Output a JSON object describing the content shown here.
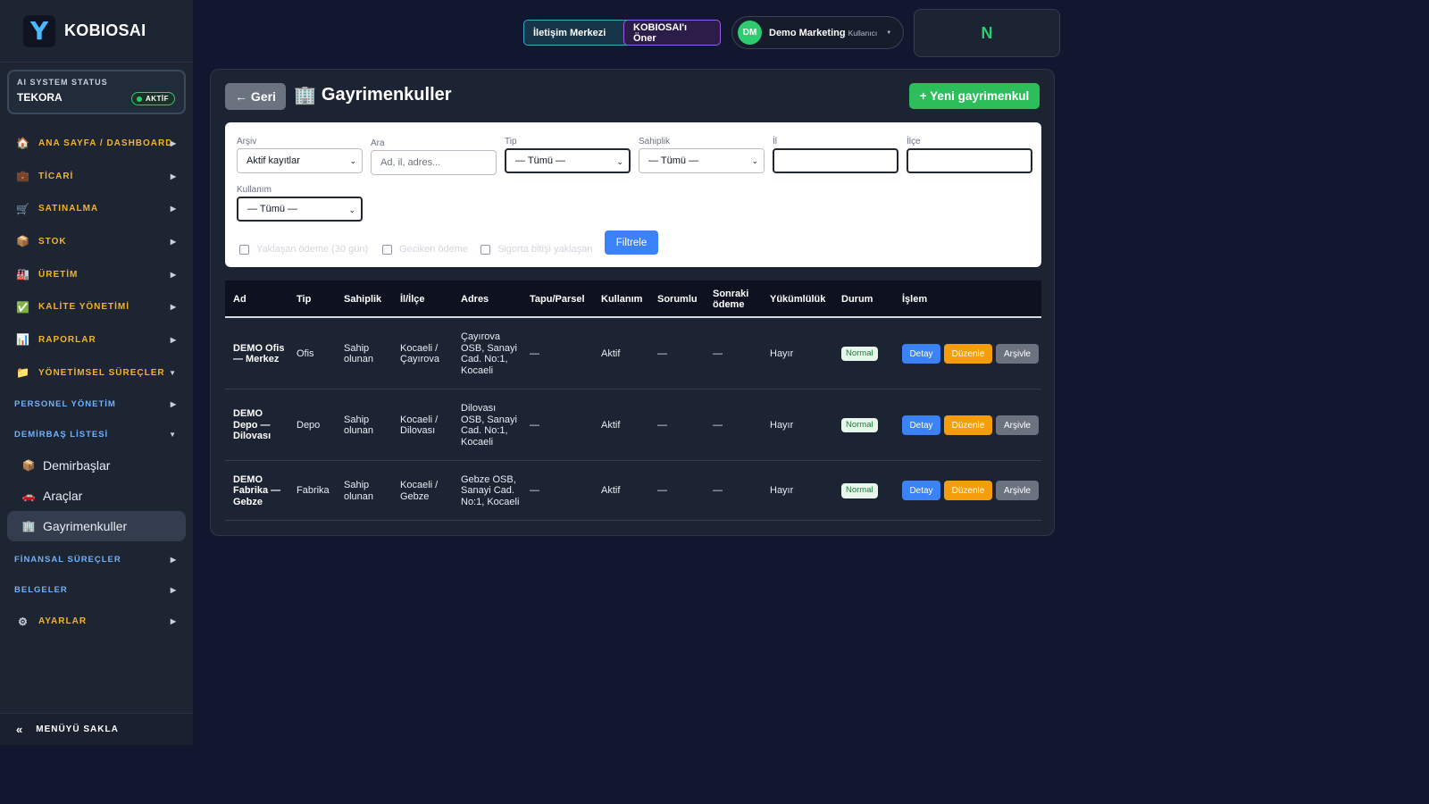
{
  "brand": {
    "logo_letter": "Y",
    "name": "KOBIOSAI"
  },
  "ai_status": {
    "label": "AI SYSTEM STATUS",
    "name": "TEKORA",
    "badge": "AKTİF"
  },
  "nav": {
    "items": [
      {
        "label": "ANA SAYFA / DASHBOARD",
        "icon": "house-icon",
        "glyph": "🏠",
        "arrow": "▶"
      },
      {
        "label": "TİCARİ",
        "icon": "briefcase-icon",
        "glyph": "💼",
        "arrow": "▶"
      },
      {
        "label": "SATINALMA",
        "icon": "cart-icon",
        "glyph": "🛒",
        "arrow": "▶"
      },
      {
        "label": "STOK",
        "icon": "box-icon",
        "glyph": "📦",
        "arrow": "▶"
      },
      {
        "label": "ÜRETİM",
        "icon": "factory-icon",
        "glyph": "🏭",
        "arrow": "▶"
      },
      {
        "label": "KALİTE YÖNETİMİ",
        "icon": "check-icon",
        "glyph": "✅",
        "arrow": "▶"
      },
      {
        "label": "RAPORLAR",
        "icon": "chart-icon",
        "glyph": "📊",
        "arrow": "▶"
      },
      {
        "label": "YÖNETİMSEL SÜREÇLER",
        "icon": "folder-icon",
        "glyph": "📁",
        "arrow": "▼"
      }
    ],
    "section_personnel": {
      "label": "PERSONEL YÖNETİM",
      "arrow": "▶"
    },
    "section_assets": {
      "label": "DEMİRBAŞ LİSTESİ",
      "arrow": "▼"
    },
    "asset_items": [
      {
        "label": "Demirbaşlar",
        "icon": "box-icon",
        "glyph": "📦"
      },
      {
        "label": "Araçlar",
        "icon": "car-icon",
        "glyph": "🚗"
      },
      {
        "label": "Gayrimenkuller",
        "icon": "building-icon",
        "glyph": "🏢"
      }
    ],
    "section_finance": {
      "label": "FİNANSAL SÜREÇLER",
      "arrow": "▶"
    },
    "section_docs": {
      "label": "BELGELER",
      "arrow": "▶"
    },
    "settings": {
      "label": "AYARLAR",
      "icon": "gear-icon",
      "glyph": "⚙",
      "arrow": "▶"
    }
  },
  "footer": {
    "label": "MENÜYÜ SAKLA",
    "glyph": "«"
  },
  "topbar": {
    "contact_label": "İletişim Merkezi",
    "recommend_label": "KOBIOSAI'ı Öner",
    "user": {
      "initials": "DM",
      "name": "Demo Marketing",
      "role": "Kullanıcı",
      "caret": "▼"
    },
    "n_label": "N"
  },
  "page": {
    "back_label": "← Geri",
    "title_glyph": "🏢",
    "title": "Gayrimenkuller",
    "new_label": "+ Yeni gayrimenkul"
  },
  "filters": {
    "archive": {
      "label": "Arşiv",
      "value": "Aktif kayıtlar"
    },
    "search": {
      "label": "Ara",
      "placeholder": "Ad, il, adres..."
    },
    "type": {
      "label": "Tip",
      "value": "— Tümü —"
    },
    "ownership": {
      "label": "Sahiplik",
      "value": "— Tümü —"
    },
    "city": {
      "label": "İl",
      "value": ""
    },
    "district": {
      "label": "İlçe",
      "value": ""
    },
    "usage": {
      "label": "Kullanım",
      "value": "— Tümü —"
    },
    "checkboxes": [
      "Yaklaşan ödeme (30 gün)",
      "Geciken ödeme",
      "Sigorta bitişi yaklaşan"
    ],
    "filter_button": "Filtrele",
    "caret": "⌄"
  },
  "table": {
    "headers": [
      "Ad",
      "Tip",
      "Sahiplik",
      "İl/İlçe",
      "Adres",
      "Tapu/Parsel",
      "Kullanım",
      "Sorumlu",
      "Sonraki ödeme",
      "Yükümlülük",
      "Durum",
      "İşlem"
    ],
    "rows": [
      {
        "name": "DEMO Ofis — Merkez",
        "type": "Ofis",
        "ownership": "Sahip olunan",
        "location": "Kocaeli / Çayırova",
        "address": "Çayırova OSB, Sanayi Cad. No:1, Kocaeli",
        "deed": "—",
        "usage": "Aktif",
        "responsible": "—",
        "next_payment": "—",
        "liability": "Hayır",
        "status": "Normal"
      },
      {
        "name": "DEMO Depo — Dilovası",
        "type": "Depo",
        "ownership": "Sahip olunan",
        "location": "Kocaeli / Dilovası",
        "address": "Dilovası OSB, Sanayi Cad. No:1, Kocaeli",
        "deed": "—",
        "usage": "Aktif",
        "responsible": "—",
        "next_payment": "—",
        "liability": "Hayır",
        "status": "Normal"
      },
      {
        "name": "DEMO Fabrika — Gebze",
        "type": "Fabrika",
        "ownership": "Sahip olunan",
        "location": "Kocaeli / Gebze",
        "address": "Gebze OSB, Sanayi Cad. No:1, Kocaeli",
        "deed": "—",
        "usage": "Aktif",
        "responsible": "—",
        "next_payment": "—",
        "liability": "Hayır",
        "status": "Normal"
      }
    ],
    "actions": {
      "detail": "Detay",
      "edit": "Düzenle",
      "archive": "Arşivle"
    }
  }
}
